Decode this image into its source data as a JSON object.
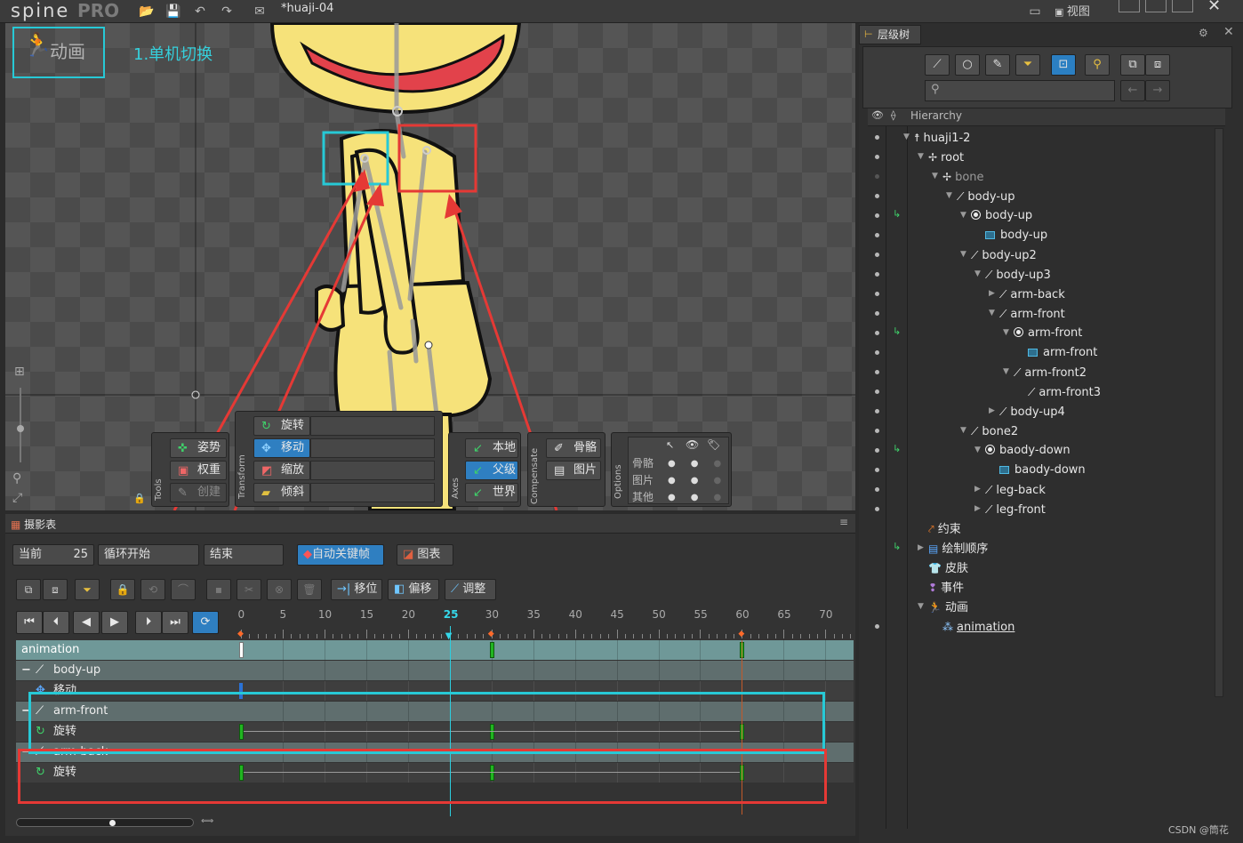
{
  "app": {
    "logo": "spine",
    "edition": "PRO",
    "document_title": "*huaji-04",
    "view_menu": "视图"
  },
  "viewport": {
    "mode_label": "动画",
    "annotation": "1.单机切换"
  },
  "tools": {
    "group_label": "Tools",
    "pose": "姿势",
    "weights": "权重",
    "create": "创建"
  },
  "transform": {
    "group_label": "Transform",
    "rotate": "旋转",
    "translate": "移动",
    "scale": "缩放",
    "shear": "倾斜"
  },
  "axes": {
    "group_label": "Axes",
    "local": "本地",
    "parent": "父级",
    "world": "世界"
  },
  "compensate": {
    "group_label": "Compensate",
    "bones": "骨骼",
    "images": "图片"
  },
  "options": {
    "group_label": "Options",
    "rows": [
      "骨骼",
      "图片",
      "其他"
    ]
  },
  "dopesheet": {
    "tab_label": "摄影表",
    "current_label": "当前",
    "current_value": "25",
    "loop_start_label": "循环开始",
    "end_label": "结束",
    "auto_key_label": "自动关键帧",
    "graph_label": "图表",
    "offset_label": "移位",
    "shift_label": "偏移",
    "adjust_label": "调整",
    "ruler": [
      "0",
      "5",
      "10",
      "15",
      "20",
      "25",
      "30",
      "35",
      "40",
      "45",
      "50",
      "55",
      "60",
      "65",
      "70"
    ],
    "current_frame": 25,
    "rows": [
      {
        "kind": "anim",
        "label": "animation",
        "keys": [
          0,
          30,
          60
        ]
      },
      {
        "kind": "bone",
        "label": "body-up",
        "keys": []
      },
      {
        "kind": "prop",
        "label": "移动",
        "keys": [
          0
        ]
      },
      {
        "kind": "bone",
        "label": "arm-front",
        "keys": []
      },
      {
        "kind": "prop",
        "label": "旋转",
        "keys": [
          0,
          30,
          60
        ]
      },
      {
        "kind": "bone",
        "label": "arm-back",
        "keys": []
      },
      {
        "kind": "prop",
        "label": "旋转",
        "keys": [
          0,
          30,
          60
        ]
      }
    ]
  },
  "hierarchy": {
    "tab_label": "层级树",
    "header_label": "Hierarchy",
    "items": [
      {
        "label": "huaji1-2",
        "depth": 0,
        "icon": "skeleton-icon",
        "arrow": "down"
      },
      {
        "label": "root",
        "depth": 1,
        "icon": "root-bone-icon",
        "arrow": "down"
      },
      {
        "label": "bone",
        "depth": 2,
        "icon": "root-bone-icon",
        "arrow": "down",
        "dim": true
      },
      {
        "label": "body-up",
        "depth": 3,
        "icon": "bone-icon",
        "arrow": "down"
      },
      {
        "label": "body-up",
        "depth": 4,
        "icon": "slot-icon",
        "arrow": "down",
        "key": true
      },
      {
        "label": "body-up",
        "depth": 5,
        "icon": "attachment-icon",
        "arrow": ""
      },
      {
        "label": "body-up2",
        "depth": 4,
        "icon": "bone-icon",
        "arrow": "down"
      },
      {
        "label": "body-up3",
        "depth": 5,
        "icon": "bone-icon",
        "arrow": "down"
      },
      {
        "label": "arm-back",
        "depth": 6,
        "icon": "bone-icon",
        "arrow": "right"
      },
      {
        "label": "arm-front",
        "depth": 6,
        "icon": "bone-icon",
        "arrow": "down"
      },
      {
        "label": "arm-front",
        "depth": 7,
        "icon": "slot-icon",
        "arrow": "down",
        "key": true
      },
      {
        "label": "arm-front",
        "depth": 8,
        "icon": "attachment-icon",
        "arrow": ""
      },
      {
        "label": "arm-front2",
        "depth": 7,
        "icon": "bone-icon",
        "arrow": "down"
      },
      {
        "label": "arm-front3",
        "depth": 8,
        "icon": "bone-icon",
        "arrow": ""
      },
      {
        "label": "body-up4",
        "depth": 6,
        "icon": "bone-icon",
        "arrow": "right"
      },
      {
        "label": "bone2",
        "depth": 4,
        "icon": "bone-icon",
        "arrow": "down"
      },
      {
        "label": "baody-down",
        "depth": 5,
        "icon": "slot-icon",
        "arrow": "down",
        "key": true
      },
      {
        "label": "baody-down",
        "depth": 6,
        "icon": "attachment-icon",
        "arrow": ""
      },
      {
        "label": "leg-back",
        "depth": 5,
        "icon": "bone-icon",
        "arrow": "right"
      },
      {
        "label": "leg-front",
        "depth": 5,
        "icon": "bone-icon",
        "arrow": "right"
      },
      {
        "label": "约束",
        "depth": 1,
        "icon": "constraint-icon",
        "arrow": "",
        "nodot": true
      },
      {
        "label": "绘制顺序",
        "depth": 1,
        "icon": "draw-order-icon",
        "arrow": "right",
        "key": true,
        "nodot": true
      },
      {
        "label": "皮肤",
        "depth": 1,
        "icon": "skin-icon",
        "arrow": "",
        "nodot": true
      },
      {
        "label": "事件",
        "depth": 1,
        "icon": "event-icon",
        "arrow": "",
        "nodot": true
      },
      {
        "label": "动画",
        "depth": 1,
        "icon": "animation-icon",
        "arrow": "down",
        "nodot": true
      },
      {
        "label": "animation",
        "depth": 2,
        "icon": "animation-clip-icon",
        "arrow": "",
        "underline": true
      }
    ]
  },
  "watermark": "CSDN @筒花",
  "colors": {
    "accent_blue": "#2f7fc1",
    "annotation_cyan": "#27c9d6",
    "annotation_red": "#e53935",
    "key_green": "#21b521",
    "figure_yellow": "#f6e27a"
  }
}
